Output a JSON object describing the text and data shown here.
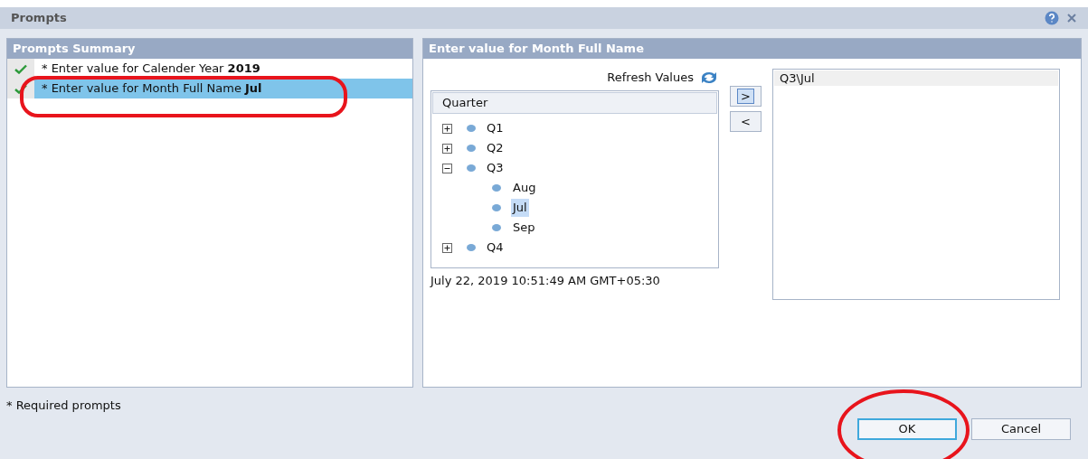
{
  "window": {
    "title": "Prompts"
  },
  "summary": {
    "title": "Prompts Summary",
    "items": [
      {
        "text": "* Enter value for Calender Year **2019**",
        "checked": true,
        "selected": false
      },
      {
        "text": "* Enter value for Month Full Name **Jul**",
        "checked": true,
        "selected": true
      }
    ]
  },
  "editor": {
    "title": "Enter value for Month Full Name",
    "refresh_label": "Refresh Values",
    "tree": {
      "header": "Quarter",
      "nodes": [
        {
          "label": "Q1",
          "expanded": false,
          "selected": false
        },
        {
          "label": "Q2",
          "expanded": false,
          "selected": false
        },
        {
          "label": "Q3",
          "expanded": true,
          "selected": false,
          "children": [
            {
              "label": "Aug",
              "selected": false
            },
            {
              "label": "Jul",
              "selected": true
            },
            {
              "label": "Sep",
              "selected": false
            }
          ]
        },
        {
          "label": "Q4",
          "expanded": false,
          "selected": false
        }
      ]
    },
    "timestamp": "July 22, 2019 10:51:49 AM GMT+05:30",
    "add_button": ">",
    "remove_button": "<",
    "selected_values": [
      {
        "text": "Q3\\Jul"
      }
    ]
  },
  "footer": {
    "note": "* Required prompts",
    "buttons": [
      {
        "label": "OK",
        "kind": "primary"
      },
      {
        "label": "Cancel",
        "kind": "secondary"
      }
    ]
  }
}
